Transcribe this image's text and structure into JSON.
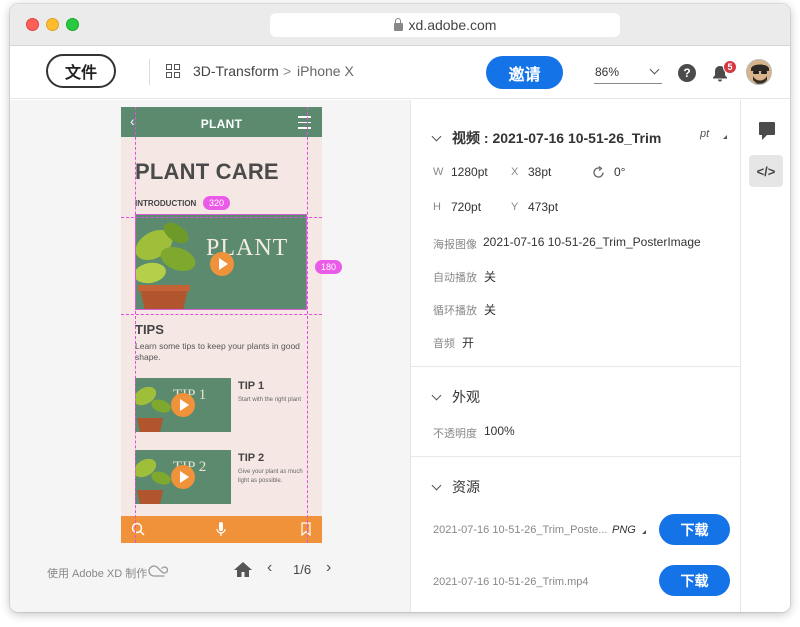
{
  "browser": {
    "url": "xd.adobe.com"
  },
  "header": {
    "file_button": "文件",
    "project": "3D-Transform",
    "chevron": ">",
    "artboard": "iPhone X",
    "invite_button": "邀请",
    "zoom": "86%",
    "help_icon": "?",
    "notification_count": "5"
  },
  "phone": {
    "title": "PLANT",
    "heading": "PLANT CARE",
    "intro": "INTRODUCTION",
    "hero_text": "PLANT",
    "tips_heading": "TIPS",
    "tips_desc": "Learn some tips to keep your plants in good shape.",
    "tips": [
      {
        "name": "TIP 1",
        "image_text": "TIP 1",
        "desc": "Start with the right plant"
      },
      {
        "name": "TIP 2",
        "image_text": "TIP 2",
        "desc": "Give your plant as much light as possible."
      }
    ]
  },
  "measure": {
    "width": "320",
    "height": "180"
  },
  "canvas_footer": {
    "made_with": "使用 Adobe XD 制作",
    "page": "1/6"
  },
  "inspector": {
    "video": {
      "title": "视频 : 2021-07-16 10-51-26_Trim",
      "unit": "pt",
      "w_label": "W",
      "w": "1280pt",
      "x_label": "X",
      "x": "38pt",
      "rotation": "0°",
      "h_label": "H",
      "h": "720pt",
      "y_label": "Y",
      "y": "473pt",
      "poster_label": "海报图像",
      "poster": "2021-07-16 10-51-26_Trim_PosterImage",
      "autoplay_label": "自动播放",
      "autoplay": "关",
      "loop_label": "循环播放",
      "loop": "关",
      "audio_label": "音频",
      "audio": "开"
    },
    "appearance": {
      "title": "外观",
      "opacity_label": "不透明度",
      "opacity": "100%"
    },
    "assets": {
      "title": "资源",
      "items": [
        {
          "name": "2021-07-16 10-51-26_Trim_Poste...",
          "format": "PNG",
          "download": "下载"
        },
        {
          "name": "2021-07-16 10-51-26_Trim.mp4",
          "download": "下载"
        }
      ]
    }
  },
  "colors": {
    "accent": "#1473e6",
    "plant_green": "#5b8a6f",
    "orange": "#f0923a",
    "guide": "#e04fe0"
  }
}
